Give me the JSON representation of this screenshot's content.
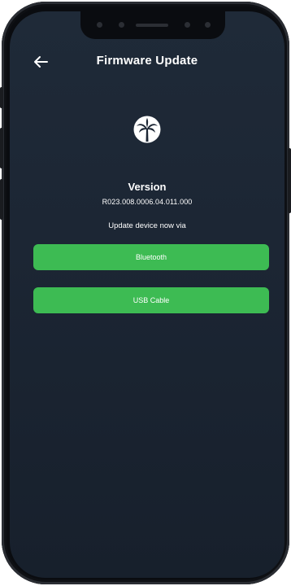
{
  "header": {
    "title": "Firmware Update",
    "back_icon": "arrow-left-icon"
  },
  "logo": {
    "icon": "palm-tree-logo"
  },
  "version": {
    "label": "Version",
    "value": "R023.008.0006.04.011.000"
  },
  "prompt": "Update device now via",
  "actions": {
    "bluetooth_label": "Bluetooth",
    "usb_label": "USB Cable"
  },
  "colors": {
    "background": "#1c2634",
    "accent_green": "#3dbb53",
    "text": "#ffffff"
  }
}
